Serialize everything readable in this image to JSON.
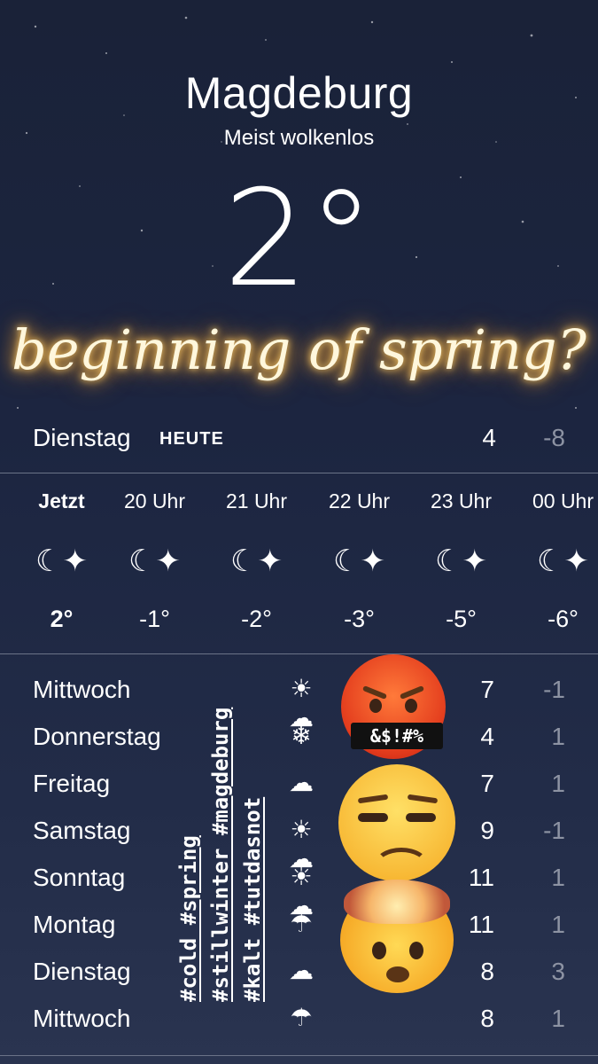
{
  "location": {
    "city": "Magdeburg",
    "condition": "Meist wolkenlos",
    "temperature": "2°"
  },
  "overlay_text": "beginning of spring?",
  "today": {
    "day": "Dienstag",
    "badge": "HEUTE",
    "high": "4",
    "low": "-8"
  },
  "hourly": [
    {
      "time": "Jetzt",
      "icon": "moon-stars-icon",
      "temp": "2°"
    },
    {
      "time": "20 Uhr",
      "icon": "moon-stars-icon",
      "temp": "-1°"
    },
    {
      "time": "21 Uhr",
      "icon": "moon-stars-icon",
      "temp": "-2°"
    },
    {
      "time": "22 Uhr",
      "icon": "moon-stars-icon",
      "temp": "-3°"
    },
    {
      "time": "23 Uhr",
      "icon": "moon-stars-icon",
      "temp": "-5°"
    },
    {
      "time": "00 Uhr",
      "icon": "moon-stars-icon",
      "temp": "-6°"
    }
  ],
  "daily": [
    {
      "day": "Mittwoch",
      "icon": "sun-cloud-icon",
      "high": "7",
      "low": "-1"
    },
    {
      "day": "Donnerstag",
      "icon": "snowflake-icon",
      "high": "4",
      "low": "1"
    },
    {
      "day": "Freitag",
      "icon": "cloud-icon",
      "high": "7",
      "low": "1"
    },
    {
      "day": "Samstag",
      "icon": "sun-cloud-icon",
      "high": "9",
      "low": "-1"
    },
    {
      "day": "Sonntag",
      "icon": "sun-cloud-icon",
      "high": "11",
      "low": "1"
    },
    {
      "day": "Montag",
      "icon": "rain-cloud-icon",
      "high": "11",
      "low": "1"
    },
    {
      "day": "Dienstag",
      "icon": "cloud-icon",
      "high": "8",
      "low": "3"
    },
    {
      "day": "Mittwoch",
      "icon": "rain-cloud-icon",
      "high": "8",
      "low": "1"
    }
  ],
  "hashtags": [
    "#cold #spring",
    "#stillwinter #magdeburg",
    "#kalt #tutdasnot"
  ],
  "sticker_text": "&$!#%",
  "icon_glyphs": {
    "moon-stars-icon": "☾✦",
    "sun-cloud-icon": "☀☁",
    "cloud-icon": "☁",
    "snowflake-icon": "❄",
    "rain-cloud-icon": "☂"
  }
}
